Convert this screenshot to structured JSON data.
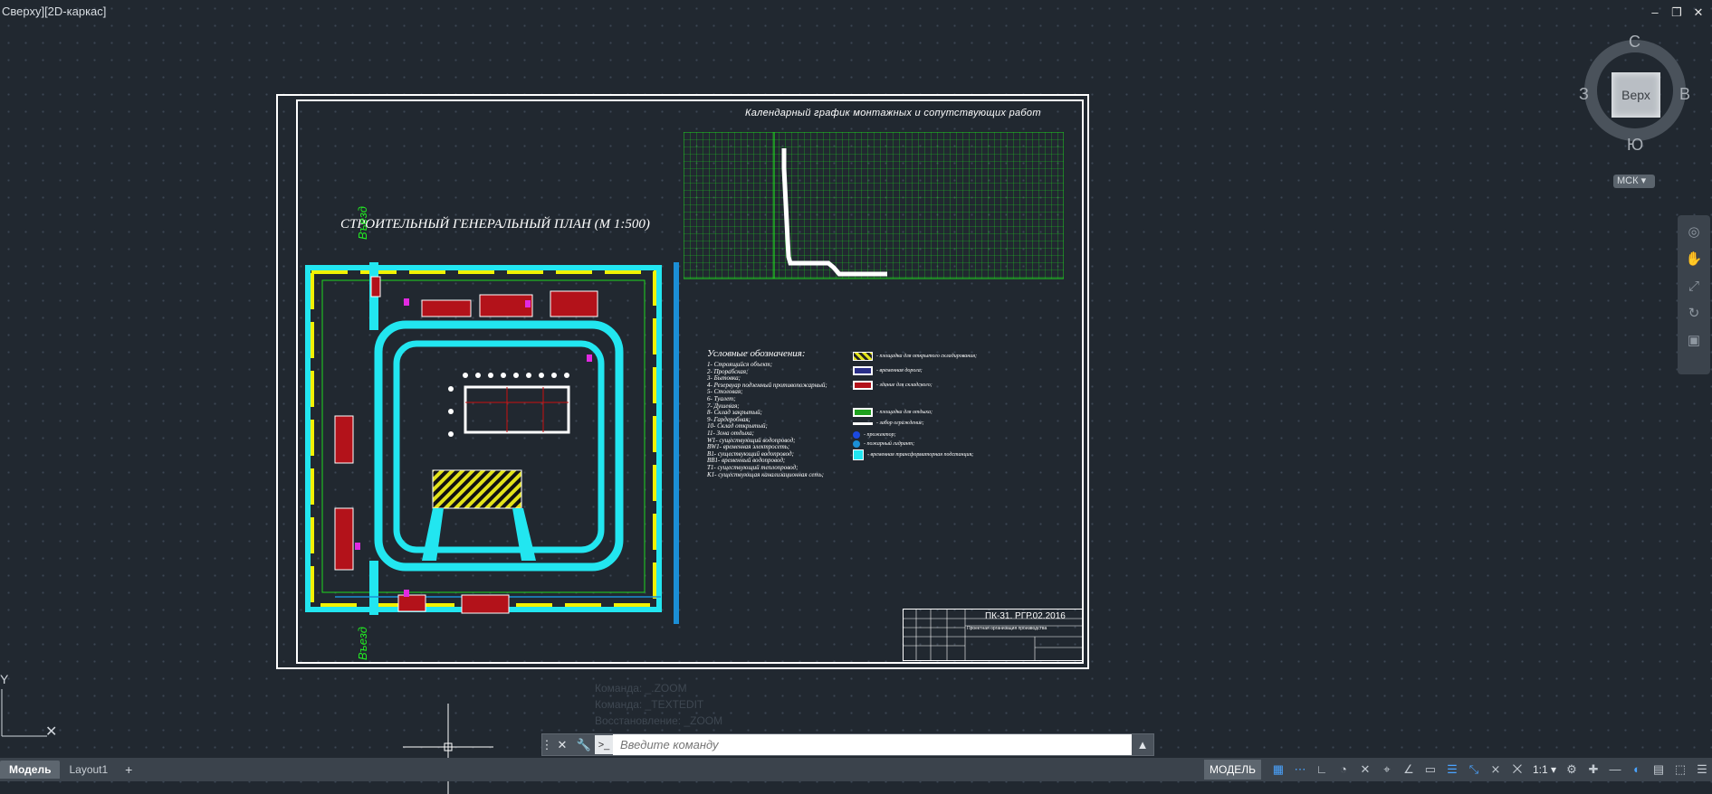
{
  "viewport": {
    "label": "Сверху][2D-каркас]"
  },
  "window_controls": {
    "minimize": "–",
    "restore": "❐",
    "close": "✕"
  },
  "viewcube": {
    "face": "Верх",
    "north": "С",
    "south": "Ю",
    "east": "В",
    "west": "З",
    "ucs": "МСК"
  },
  "drawing": {
    "plan_title": "СТРОИТЕЛЬНЫЙ ГЕНЕРАЛЬНЫЙ ПЛАН (М 1:500)",
    "schedule_title": "Календарный график монтажных и сопутствующих работ",
    "entry_top": "Въезд",
    "entry_bottom": "Въезд",
    "legend_title": "Условные обозначения:",
    "legend_items": [
      "1- Строящийся объект;",
      "2- Прорабская;",
      "3- Бытовка;",
      "4- Резервуар подземный противопожарный;",
      "5- Столовая;",
      "6- Туалет;",
      "7- Душевая;",
      "8- Склад закрытый;",
      "9- Гардеробная;",
      "10- Склад открытый;",
      "11- Зона отдыха;",
      "W1- существующий водопровод;",
      "BW1- временная электросеть;",
      "B1- существующий водопровод;",
      "BB1- временный водопровод;",
      "T1- существующий теплопровод;",
      "K1- существующая канализационная сеть;"
    ],
    "legend_symbols": [
      "- площадка для открытого складирования;",
      "- временная дорога;",
      "- здание для складского;",
      "- площадка для отдыха;",
      "- забор ограждение;",
      "- прожектор;",
      "- пожарный гидрант;",
      "- временная трансформаторная подстанция;"
    ],
    "title_block": {
      "code": "ПК-31. РГР.02.2016",
      "subtitle": "Проектная организация производства"
    }
  },
  "command": {
    "history": [
      "Команда: _.ZOOM",
      "Команда: _TEXTEDIT",
      "Восстановление: _ZOOM"
    ],
    "placeholder": "Введите команду"
  },
  "tabs": [
    {
      "label": "Модель",
      "active": true
    },
    {
      "label": "Layout1",
      "active": false
    }
  ],
  "status": {
    "model": "МОДЕЛЬ",
    "scale": "1:1"
  },
  "colors": {
    "background": "#212830",
    "cyan": "#22e6f0",
    "yellow": "#f2f200",
    "green": "#1fd61f",
    "red": "#b3121a"
  }
}
